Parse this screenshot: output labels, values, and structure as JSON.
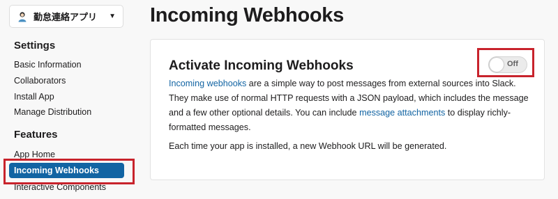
{
  "sidebar": {
    "app_name": "勤怠連絡アプリ",
    "sections": [
      {
        "heading": "Settings",
        "items": [
          "Basic Information",
          "Collaborators",
          "Install App",
          "Manage Distribution"
        ]
      },
      {
        "heading": "Features",
        "items": [
          "App Home",
          "Incoming Webhooks",
          "Interactive Components"
        ]
      }
    ],
    "active_item": "Incoming Webhooks"
  },
  "main": {
    "title": "Incoming Webhooks",
    "card": {
      "title": "Activate Incoming Webhooks",
      "toggle_label": "Off",
      "desc_link1": "Incoming webhooks",
      "desc_part1": " are a simple way to post messages from external sources into Slack. They make use of normal HTTP requests with a JSON payload, which includes the message and a few other optional details. You can include ",
      "desc_link2": "message attachments",
      "desc_part2": " to display richly-formatted messages.",
      "note": "Each time your app is installed, a new Webhook URL will be generated."
    }
  },
  "colors": {
    "accent": "#1264a3",
    "highlight_box": "#c8232c"
  },
  "icons": {
    "app": "app-avatar-icon",
    "dropdown": "chevron-down-icon"
  }
}
